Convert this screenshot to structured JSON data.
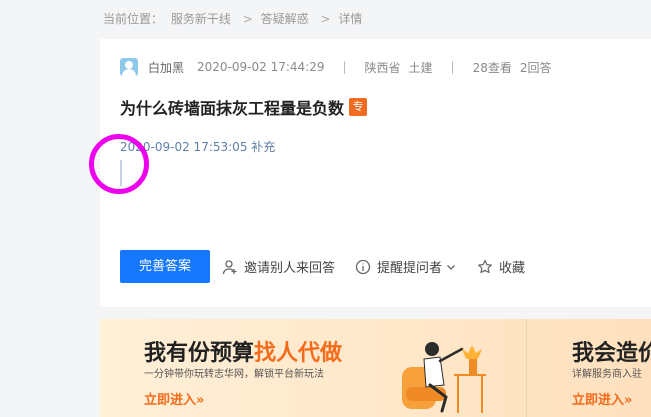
{
  "breadcrumb": {
    "label": "当前位置：",
    "items": [
      "服务新干线",
      "答疑解惑",
      "详情"
    ],
    "separator": ">"
  },
  "question": {
    "author": "白加黑",
    "datetime": "2020-09-02 17:44:29",
    "province": "陕西省",
    "category": "土建",
    "views": "28查看",
    "answers": "2回答",
    "separator": "|",
    "title": "为什么砖墙面抹灰工程量是负数",
    "badge": "专",
    "supplement": "2020-09-02 17:53:05 补充"
  },
  "actions": {
    "improve_answer": "完善答案",
    "invite": "邀请别人来回答",
    "remind": "提醒提问者",
    "favorite": "收藏"
  },
  "banner": {
    "left": {
      "title_pre": "我有份预算",
      "title_highlight": "找人代做",
      "subtitle": "一分钟带你玩转志华网，解锁平台新玩法",
      "link": "立即进入»"
    },
    "right": {
      "title": "我会造价",
      "subtitle": "详解服务商入驻",
      "link": "立即进入»"
    }
  },
  "colors": {
    "primary": "#1677ff",
    "accent": "#f46b1c",
    "highlight_circle": "#ee00ee"
  }
}
